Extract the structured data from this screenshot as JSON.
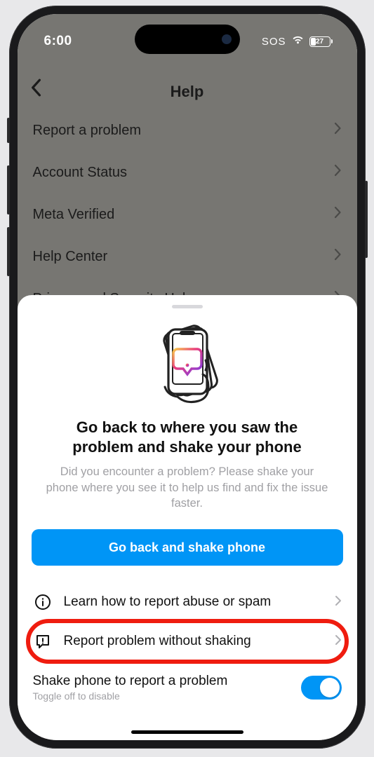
{
  "status": {
    "time": "6:00",
    "sos": "SOS",
    "battery": "27"
  },
  "header": {
    "title": "Help"
  },
  "menu": {
    "items": [
      {
        "label": "Report a problem"
      },
      {
        "label": "Account Status"
      },
      {
        "label": "Meta Verified"
      },
      {
        "label": "Help Center"
      },
      {
        "label": "Privacy and Security Help"
      }
    ]
  },
  "sheet": {
    "title": "Go back to where you saw the problem and shake your phone",
    "subtitle": "Did you encounter a problem? Please shake your phone where you see it to help us find and fix the issue faster.",
    "primary_button": "Go back and shake phone",
    "options": [
      {
        "label": "Learn how to report abuse or spam"
      },
      {
        "label": "Report problem without shaking"
      }
    ],
    "toggle": {
      "title": "Shake phone to report a problem",
      "subtitle": "Toggle off to disable",
      "on": true
    }
  }
}
